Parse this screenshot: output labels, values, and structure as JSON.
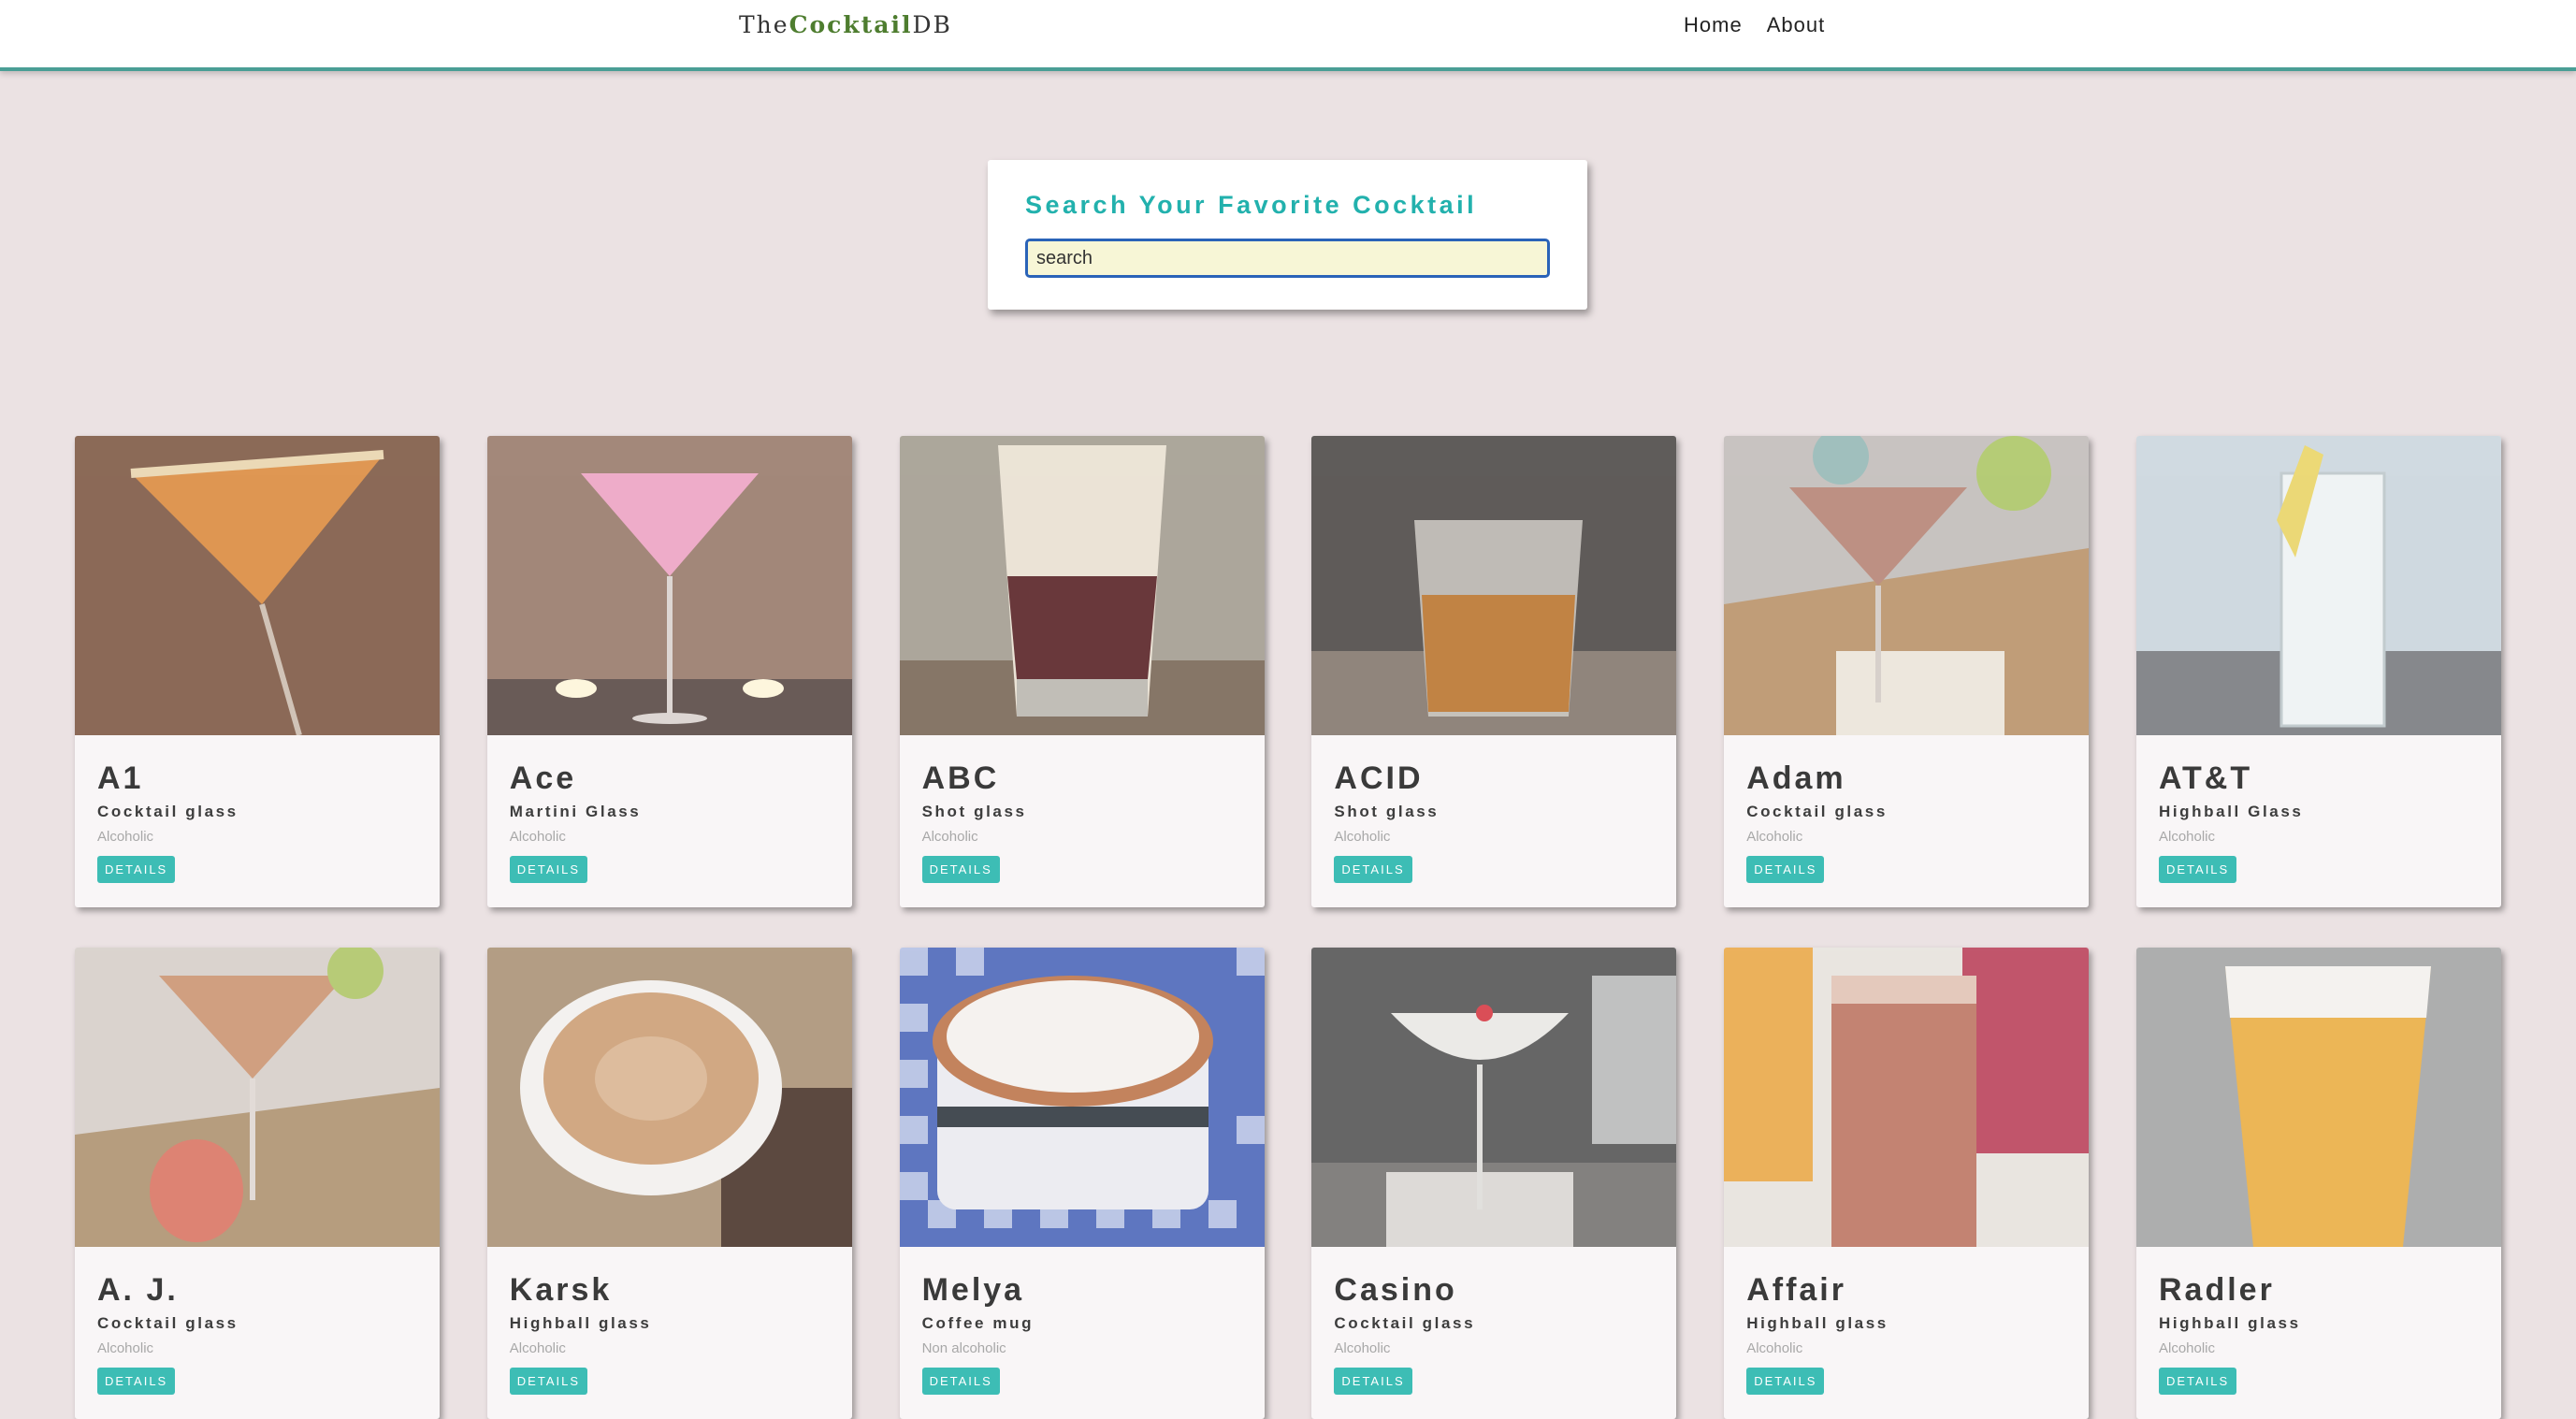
{
  "nav": {
    "brand_prefix": "The",
    "brand_strong": "Cocktail",
    "brand_suffix": "DB",
    "links": [
      "Home",
      "About"
    ]
  },
  "search": {
    "title": "Search Your Favorite Cocktail",
    "value": "search",
    "placeholder": "search"
  },
  "details_label": "DETAILS",
  "colors": {
    "brand_strong": "#4e7d2f",
    "accent_teal": "#22b1ad",
    "button_teal": "#3dbdb5",
    "background": "#ebe2e3"
  },
  "cocktails": [
    {
      "name": "A1",
      "glass": "Cocktail glass",
      "type": "Alcoholic",
      "image": "martini-sugar-rim"
    },
    {
      "name": "Ace",
      "glass": "Martini Glass",
      "type": "Alcoholic",
      "image": "pink-martini-candles"
    },
    {
      "name": "ABC",
      "glass": "Shot glass",
      "type": "Alcoholic",
      "image": "layered-shot"
    },
    {
      "name": "ACID",
      "glass": "Shot glass",
      "type": "Alcoholic",
      "image": "whiskey-rocks"
    },
    {
      "name": "Adam",
      "glass": "Cocktail glass",
      "type": "Alcoholic",
      "image": "martini-lime"
    },
    {
      "name": "AT&T",
      "glass": "Highball Glass",
      "type": "Alcoholic",
      "image": "highball-lemon"
    },
    {
      "name": "A. J.",
      "glass": "Cocktail glass",
      "type": "Alcoholic",
      "image": "martini-grapefruit"
    },
    {
      "name": "Karsk",
      "glass": "Highball glass",
      "type": "Alcoholic",
      "image": "coffee-cup-beans"
    },
    {
      "name": "Melya",
      "glass": "Coffee mug",
      "type": "Non alcoholic",
      "image": "coffee-mug-gingham"
    },
    {
      "name": "Casino",
      "glass": "Cocktail glass",
      "type": "Alcoholic",
      "image": "coupe-cherry"
    },
    {
      "name": "Affair",
      "glass": "Highball glass",
      "type": "Alcoholic",
      "image": "highball-juice"
    },
    {
      "name": "Radler",
      "glass": "Highball glass",
      "type": "Alcoholic",
      "image": "pint-beer"
    }
  ]
}
